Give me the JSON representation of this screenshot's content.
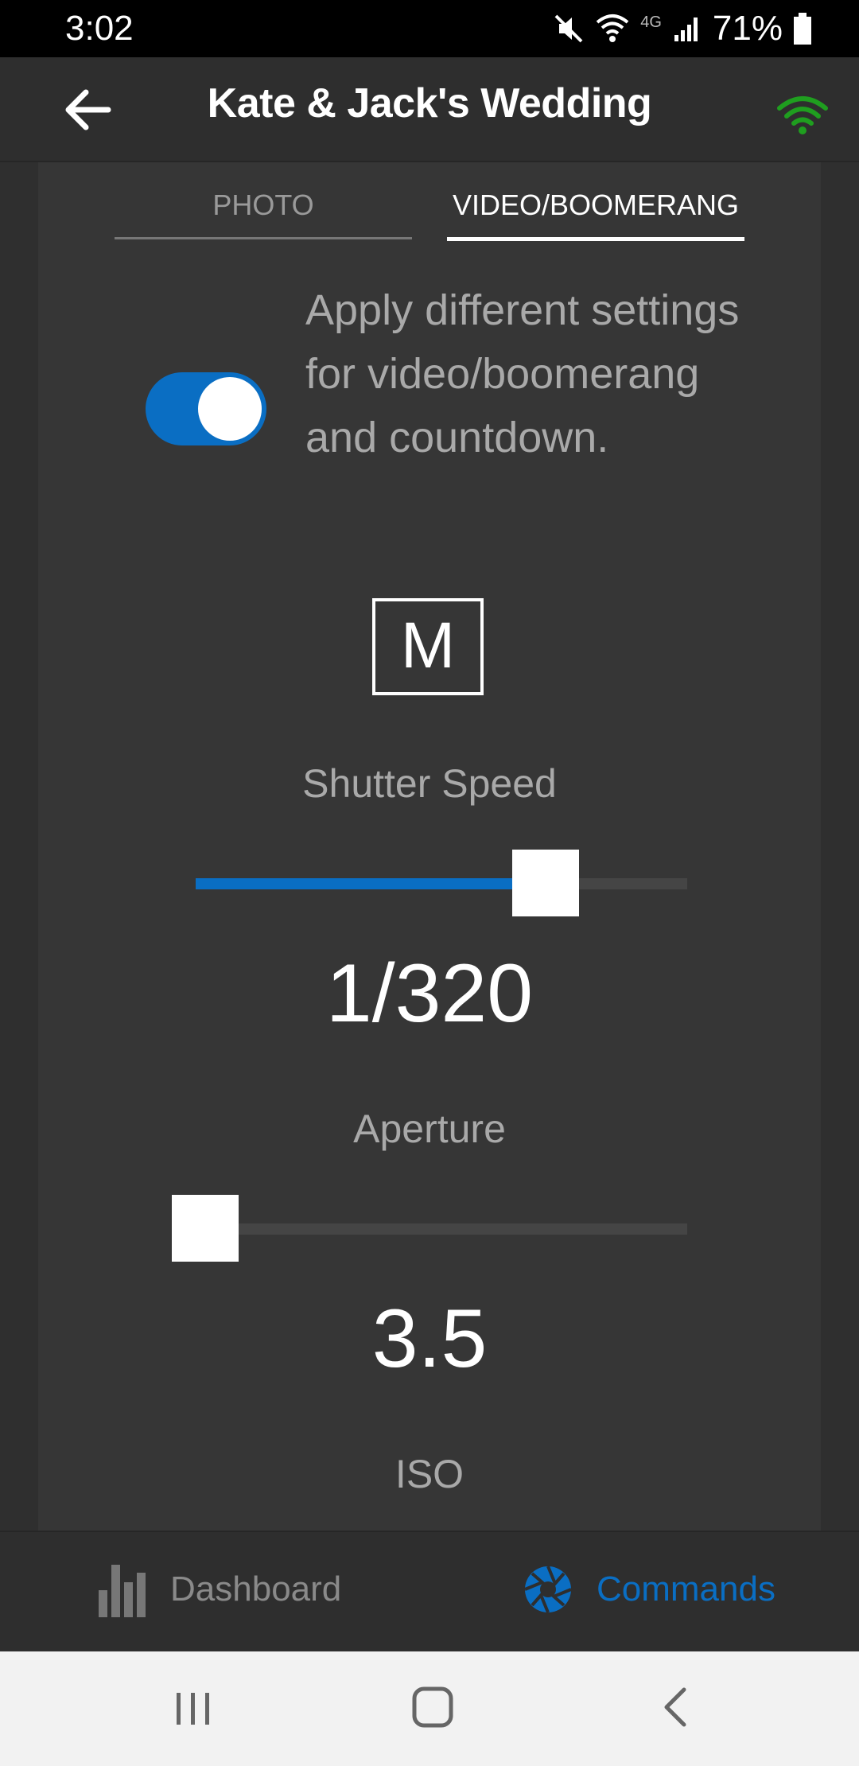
{
  "status_bar": {
    "time": "3:02",
    "network": "4G",
    "battery": "71%"
  },
  "header": {
    "title": "Kate & Jack's Wedding",
    "wifi_color": "#1f9e1f"
  },
  "tabs": [
    {
      "label": "PHOTO",
      "active": false
    },
    {
      "label": "VIDEO/BOOMERANG",
      "active": true
    }
  ],
  "settings_toggle": {
    "on": true,
    "description": "Apply different settings for video/boomerang and countdown."
  },
  "mode": {
    "label": "M"
  },
  "shutter_speed": {
    "label": "Shutter Speed",
    "value": "1/320",
    "level": 0.72
  },
  "aperture": {
    "label": "Aperture",
    "value": "3.5",
    "level": 0.0
  },
  "iso": {
    "label": "ISO"
  },
  "bottom_nav": {
    "dashboard": {
      "label": "Dashboard"
    },
    "commands": {
      "label": "Commands",
      "active": true
    }
  },
  "colors": {
    "accent": "#0a6ec3",
    "background": "#2f2f2f",
    "panel": "#363636"
  }
}
